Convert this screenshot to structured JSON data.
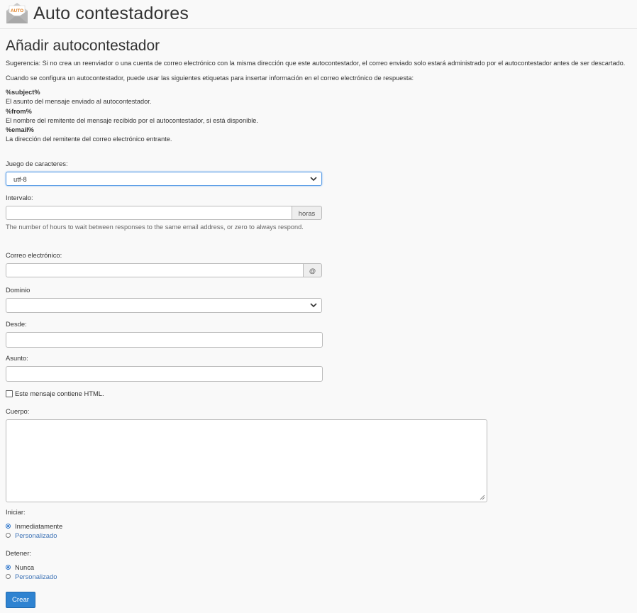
{
  "header": {
    "title": "Auto contestadores",
    "icon_label": "AUTO",
    "icon_name": "envelope-auto-icon"
  },
  "page": {
    "heading": "Añadir autocontestador",
    "tip": "Sugerencia: Si no crea un reenviador o una cuenta de correo electrónico con la misma dirección que este autocontestador, el correo enviado solo estará administrado por el autocontestador antes de ser descartado.",
    "info": "Cuando se configura un autocontestador, puede usar las siguientes etiquetas para insertar información en el correo electrónico de respuesta:",
    "tags": [
      {
        "tag": "%subject%",
        "desc": "El asunto del mensaje enviado al autocontestador."
      },
      {
        "tag": "%from%",
        "desc": "El nombre del remitente del mensaje recibido por el autocontestador, si está disponible."
      },
      {
        "tag": "%email%",
        "desc": "La dirección del remitente del correo electrónico entrante."
      }
    ]
  },
  "form": {
    "charset": {
      "label": "Juego de caracteres:",
      "value": "utf-8"
    },
    "interval": {
      "label": "Intervalo:",
      "value": "",
      "addon": "horas",
      "help": "The number of hours to wait between responses to the same email address, or zero to always respond."
    },
    "email": {
      "label": "Correo electrónico:",
      "value": "",
      "addon": "@"
    },
    "domain": {
      "label": "Dominio",
      "value": ""
    },
    "from": {
      "label": "Desde:",
      "value": ""
    },
    "subject": {
      "label": "Asunto:",
      "value": ""
    },
    "html_checkbox": {
      "label": "Este mensaje contiene HTML.",
      "checked": false
    },
    "body": {
      "label": "Cuerpo:",
      "value": ""
    },
    "start": {
      "label": "Iniciar:",
      "options": [
        "Inmediatamente",
        "Personalizado"
      ],
      "selected": "Inmediatamente"
    },
    "stop": {
      "label": "Detener:",
      "options": [
        "Nunca",
        "Personalizado"
      ],
      "selected": "Nunca"
    },
    "submit_label": "Crear"
  },
  "colors": {
    "accent": "#2f83d1",
    "link": "#3f74b7",
    "focus": "#5c9ee6"
  }
}
